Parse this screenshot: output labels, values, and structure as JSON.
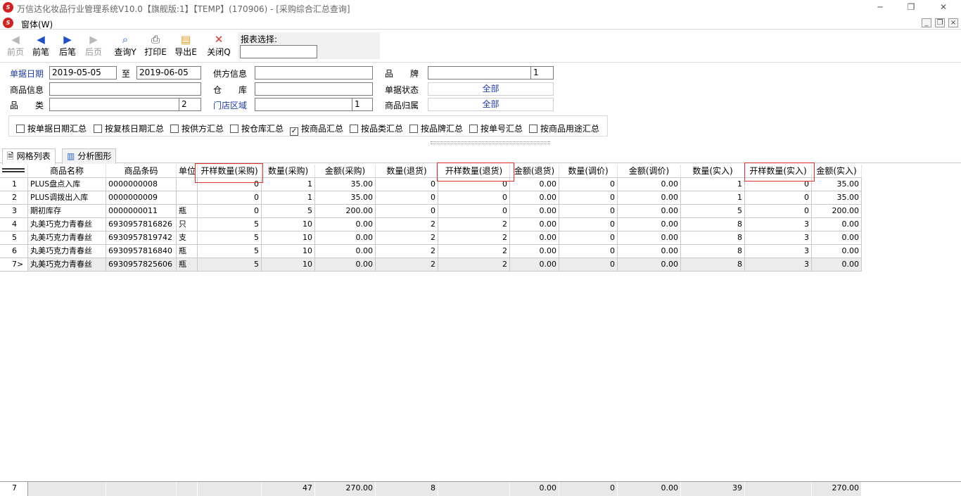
{
  "window": {
    "title": "万信达化妆品行业管理系统V10.0【旗舰版:1】【TEMP】(170906) - [采购综合汇总查询]",
    "logo_text": "S"
  },
  "menu": {
    "label": "窗体(W)"
  },
  "toolbar": {
    "first": "前页",
    "prev": "前笔",
    "next": "后笔",
    "last": "后页",
    "query": "查询Y",
    "print": "打印E",
    "export": "导出E",
    "close": "关闭Q",
    "report_label": "报表选择:",
    "report_value": ""
  },
  "filters": {
    "date_label": "单据日期",
    "date_from": "2019-05-05",
    "to_label": "至",
    "date_to": "2019-06-05",
    "supplier_label": "供方信息",
    "supplier_value": "",
    "brand_label": "品　　牌",
    "brand_value": "",
    "brand_code": "1",
    "product_label": "商品信息",
    "product_value": "",
    "warehouse_label": "仓　　库",
    "warehouse_value": "",
    "status_label": "单据状态",
    "status_value": "全部",
    "category_label": "品　　类",
    "category_value": "",
    "category_code": "2",
    "region_label": "门店区域",
    "region_value": "",
    "region_code": "1",
    "belong_label": "商品归属",
    "belong_value": "全部"
  },
  "checkboxes": [
    {
      "label": "按单据日期汇总",
      "checked": false
    },
    {
      "label": "按复核日期汇总",
      "checked": false
    },
    {
      "label": "按供方汇总",
      "checked": false
    },
    {
      "label": "按仓库汇总",
      "checked": false
    },
    {
      "label": "按商品汇总",
      "checked": true
    },
    {
      "label": "按品类汇总",
      "checked": false
    },
    {
      "label": "按品牌汇总",
      "checked": false
    },
    {
      "label": "按单号汇总",
      "checked": false
    },
    {
      "label": "按商品用途汇总",
      "checked": false
    }
  ],
  "tabs": {
    "grid": "网格列表",
    "chart": "分析图形"
  },
  "grid": {
    "headers": [
      "商品名称",
      "商品条码",
      "单位",
      "开样数量(采购)",
      "数量(采购)",
      "金额(采购)",
      "数量(退货)",
      "开样数量(退货)",
      "金额(退货)",
      "数量(调价)",
      "金额(调价)",
      "数量(实入)",
      "开样数量(实入)",
      "金额(实入)"
    ],
    "rows": [
      {
        "no": "1",
        "cells": [
          "PLUS盘点入库",
          "0000000008",
          "",
          "0",
          "1",
          "35.00",
          "0",
          "0",
          "0.00",
          "0",
          "0.00",
          "1",
          "0",
          "35.00"
        ]
      },
      {
        "no": "2",
        "cells": [
          "PLUS调拨出入库",
          "0000000009",
          "",
          "0",
          "1",
          "35.00",
          "0",
          "0",
          "0.00",
          "0",
          "0.00",
          "1",
          "0",
          "35.00"
        ]
      },
      {
        "no": "3",
        "cells": [
          "期初库存",
          "0000000011",
          "瓶",
          "0",
          "5",
          "200.00",
          "0",
          "0",
          "0.00",
          "0",
          "0.00",
          "5",
          "0",
          "200.00"
        ]
      },
      {
        "no": "4",
        "cells": [
          "丸美巧克力青春丝",
          "6930957816826",
          "只",
          "5",
          "10",
          "0.00",
          "2",
          "2",
          "0.00",
          "0",
          "0.00",
          "8",
          "3",
          "0.00"
        ]
      },
      {
        "no": "5",
        "cells": [
          "丸美巧克力青春丝",
          "6930957819742",
          "支",
          "5",
          "10",
          "0.00",
          "2",
          "2",
          "0.00",
          "0",
          "0.00",
          "8",
          "3",
          "0.00"
        ]
      },
      {
        "no": "6",
        "cells": [
          "丸美巧克力青春丝",
          "6930957816840",
          "瓶",
          "5",
          "10",
          "0.00",
          "2",
          "2",
          "0.00",
          "0",
          "0.00",
          "8",
          "3",
          "0.00"
        ]
      },
      {
        "no": "7>",
        "cells": [
          "丸美巧克力青春丝",
          "6930957825606",
          "瓶",
          "5",
          "10",
          "0.00",
          "2",
          "2",
          "0.00",
          "0",
          "0.00",
          "8",
          "3",
          "0.00"
        ]
      }
    ],
    "footer": {
      "count": "7",
      "cells": [
        "",
        "",
        "",
        "",
        "47",
        "270.00",
        "8",
        "",
        "0.00",
        "0",
        "0.00",
        "39",
        "",
        "270.00"
      ]
    }
  },
  "colors": {
    "highlight_border": "#e0302a",
    "link_blue": "#1e3ca8"
  }
}
